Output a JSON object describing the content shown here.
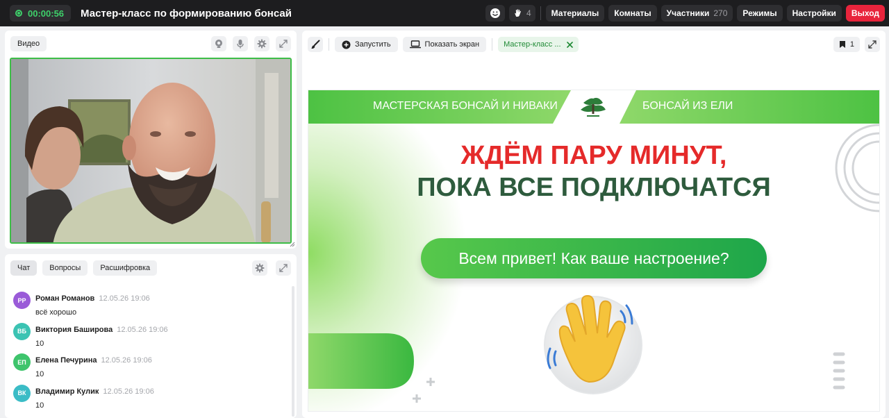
{
  "header": {
    "timer": "00:00:56",
    "title": "Мастер-класс по формированию бонсай",
    "hands_count": "4",
    "menu": {
      "materials": "Материалы",
      "rooms": "Комнаты",
      "participants": "Участники",
      "participants_count": "270",
      "modes": "Режимы",
      "settings": "Настройки",
      "exit": "Выход"
    }
  },
  "video_panel": {
    "label": "Видео"
  },
  "chat_panel": {
    "tabs": [
      "Чат",
      "Вопросы",
      "Расшифровка"
    ],
    "messages": [
      {
        "initials": "РР",
        "name": "Роман Романов",
        "time": "12.05.26 19:06",
        "text": "всё хорошо",
        "color": "#9a5bd8"
      },
      {
        "initials": "ВБ",
        "name": "Виктория Баширова",
        "time": "12.05.26 19:06",
        "text": "10",
        "color": "#3bc3b3"
      },
      {
        "initials": "ЕП",
        "name": "Елена Печурина",
        "time": "12.05.26 19:06",
        "text": "10",
        "color": "#3ec46c"
      },
      {
        "initials": "ВК",
        "name": "Владимир Кулик",
        "time": "12.05.26 19:06",
        "text": "10",
        "color": "#3bbcc6"
      }
    ]
  },
  "main_panel": {
    "toolbar": {
      "launch": "Запустить",
      "share_screen": "Показать экран",
      "doc_tab": "Мастер-класс ...",
      "bookmark_count": "1"
    },
    "slide": {
      "banner_left": "МАСТЕРСКАЯ БОНСАЙ И НИВАКИ",
      "banner_right": "БОНСАЙ ИЗ ЕЛИ",
      "headline_1": "ЖДЁМ ПАРУ МИНУТ,",
      "headline_2": "ПОКА ВСЕ ПОДКЛЮЧАТСЯ",
      "button_text": "Всем привет! Как ваше настроение?"
    }
  },
  "colors": {
    "accent_green": "#3dbd47",
    "exit_red": "#e8243c",
    "headline_red": "#e52a2a",
    "headline_dark_green": "#2e5b3d"
  }
}
